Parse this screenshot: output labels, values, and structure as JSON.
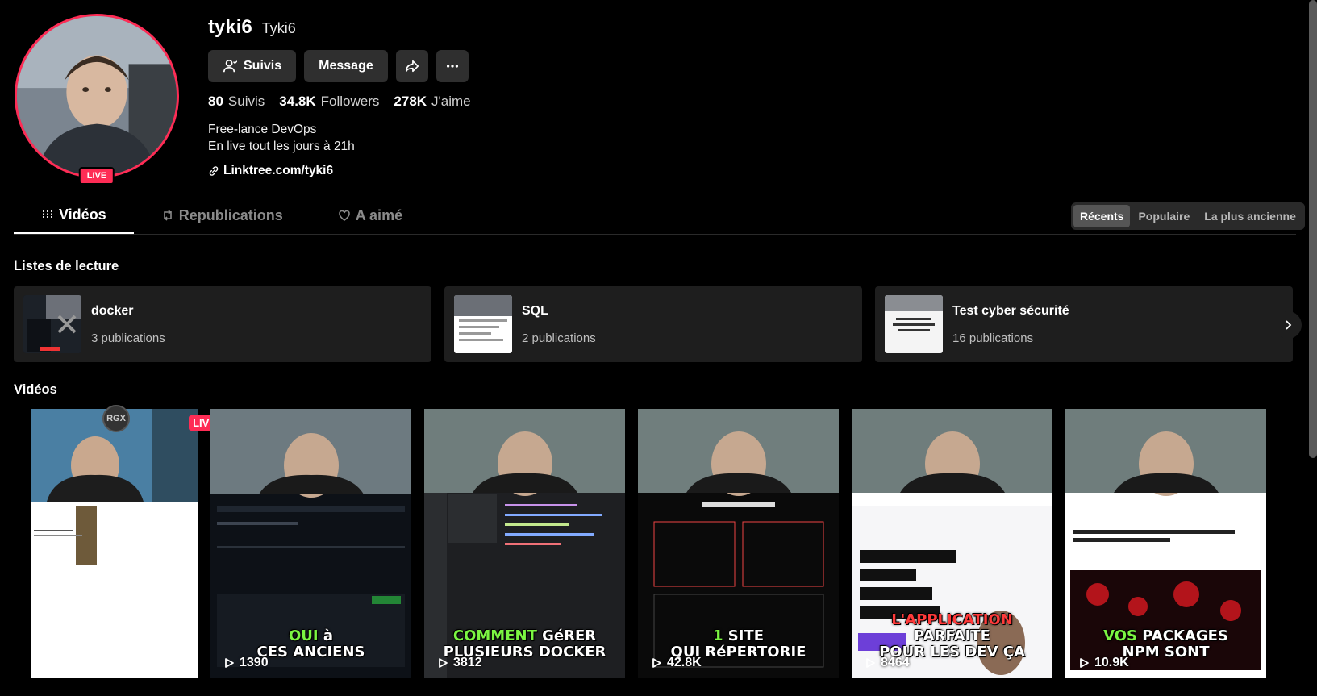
{
  "profile": {
    "username": "tyki6",
    "nickname": "Tyki6",
    "live_badge": "LIVE",
    "follow_label": "Suivis",
    "message_label": "Message",
    "stats": [
      {
        "value": "80",
        "label": "Suivis"
      },
      {
        "value": "34.8K",
        "label": "Followers"
      },
      {
        "value": "278K",
        "label": "J'aime"
      }
    ],
    "bio_line1": "Free-lance DevOps",
    "bio_line2": "En live tout les jours à 21h",
    "link": "Linktree.com/tyki6"
  },
  "tabs": [
    {
      "label": "Vidéos",
      "icon": "grid-icon",
      "active": true
    },
    {
      "label": "Republications",
      "icon": "repost-icon",
      "active": false
    },
    {
      "label": "A aimé",
      "icon": "heart-icon",
      "active": false
    }
  ],
  "sort": [
    {
      "label": "Récents",
      "active": true
    },
    {
      "label": "Populaire",
      "active": false
    },
    {
      "label": "La plus ancienne",
      "active": false
    }
  ],
  "playlists_title": "Listes de lecture",
  "playlists": [
    {
      "name": "docker",
      "count": "3 publications"
    },
    {
      "name": "SQL",
      "count": "2 publications"
    },
    {
      "name": "Test cyber sécurité",
      "count": "16 publications"
    }
  ],
  "videos_title": "Vidéos",
  "videos": [
    {
      "live": "LIVE",
      "avatar": "RGX"
    },
    {
      "caption_hl": "OUI",
      "caption_rest": " à",
      "caption_line2": "CES ANCIENS",
      "views": "1390"
    },
    {
      "caption_hl": "COMMENT",
      "caption_rest": " GéRER",
      "caption_line2": "PLUSIEURS DOCKER",
      "views": "3812"
    },
    {
      "caption_hl": "1",
      "caption_rest": " SITE",
      "caption_line2": "QUI RéPERTORIE",
      "views": "42.8K"
    },
    {
      "caption_red": "L'APPLICATION",
      "caption_line2": "PARFAITE",
      "caption_line3": "POUR LES DEV ÇA",
      "views": "8464"
    },
    {
      "caption_hl": "VOS",
      "caption_rest": " PACKAGES",
      "caption_line2": "NPM SONT",
      "views": "10.9K"
    }
  ],
  "colors": {
    "accent": "#fe2c55",
    "background": "#000000",
    "card": "#1e1e1e"
  }
}
